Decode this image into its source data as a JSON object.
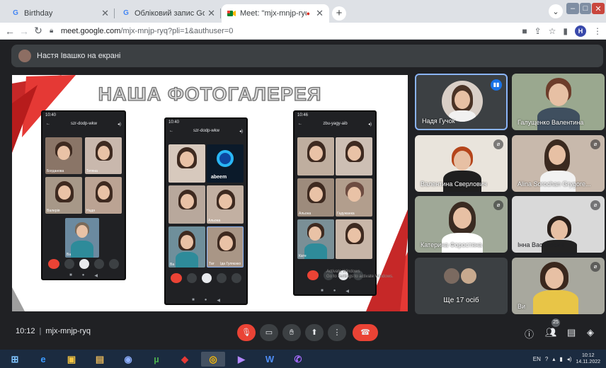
{
  "browser": {
    "tabs": [
      {
        "label": "Birthday",
        "favicon": "G",
        "active": false
      },
      {
        "label": "Обліковий запис Google",
        "favicon": "G",
        "active": false
      },
      {
        "label": "Meet: \"mjx-mnjp-ryq\"",
        "favicon": "meet-icon",
        "active": true
      }
    ],
    "url_host": "meet.google.com",
    "url_path": "/mjx-mnjp-ryq?pli=1&authuser=0",
    "profile_initial": "H"
  },
  "meet": {
    "presenter_text": "Настя Івашко на екрані",
    "slide": {
      "title": "НАША ФОТОГАЛЕРЕЯ",
      "phones": [
        {
          "time": "10:40",
          "code": "szr-dodp-wkw",
          "tiles": [
            "Богданова",
            "Тетяна",
            "Валерія",
            "Надя",
            "Ва"
          ]
        },
        {
          "time": "10:40",
          "code": "szr-dodp-wkw",
          "tiles": [
            "",
            "abeem",
            "",
            "Альона",
            "Ва",
            "Тат",
            "Іда Гуляєнко"
          ]
        },
        {
          "time": "10:46",
          "code": "zbu-yagy-aib",
          "tiles": [
            "",
            "",
            "Альона",
            "Гадужанка",
            "Кате",
            ""
          ]
        }
      ],
      "watermark_line1": "Activate Windows",
      "watermark_line2": "Go to Settings to activate Windows."
    },
    "participants": [
      {
        "name": "Надя Гучок",
        "speaking": true
      },
      {
        "name": "Галущенко Валентина",
        "speaking": false
      },
      {
        "name": "Валентина Сверлович",
        "speaking": false
      },
      {
        "name": "Alina Sorochan Grygore...",
        "speaking": false
      },
      {
        "name": "Катерина Форостяна",
        "speaking": false
      },
      {
        "name": "Інна Василович",
        "speaking": false
      },
      {
        "name": "Ще 17 осіб",
        "speaking": false
      },
      {
        "name": "Ви",
        "speaking": false
      }
    ],
    "time": "10:12",
    "meeting_code": "mjx-mnjp-ryq",
    "participant_count": "25"
  },
  "taskbar": {
    "lang": "EN",
    "time": "10:12",
    "date": "14.11.2022"
  },
  "colors": {
    "meet_bg": "#202124",
    "tile_bg": "#3c4043",
    "red": "#ea4335",
    "accent_blue": "#8ab4f8"
  }
}
